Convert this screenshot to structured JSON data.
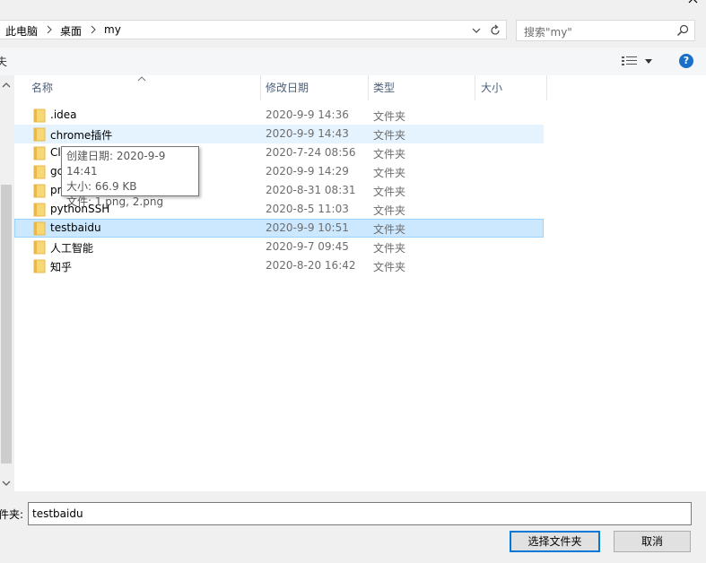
{
  "breadcrumb": [
    "此电脑",
    "桌面",
    "my"
  ],
  "search": {
    "placeholder": "搜索\"my\""
  },
  "toolbar": {
    "left_partial": "夫"
  },
  "columns": {
    "name": "名称",
    "date": "修改日期",
    "type": "类型",
    "size": "大小"
  },
  "files": [
    {
      "name": ".idea",
      "date": "2020-9-9 14:36",
      "type": "文件夹"
    },
    {
      "name": "chrome插件",
      "date": "2020-9-9 14:43",
      "type": "文件夹"
    },
    {
      "name": "Cl",
      "date": "2020-7-24 08:56",
      "type": "文件夹"
    },
    {
      "name": "gc",
      "date": "2020-9-9 14:29",
      "type": "文件夹"
    },
    {
      "name": "pr",
      "date": "2020-8-31 08:31",
      "type": "文件夹"
    },
    {
      "name": "pythonSSH",
      "date": "2020-8-5 11:03",
      "type": "文件夹"
    },
    {
      "name": "testbaidu",
      "date": "2020-9-9 10:51",
      "type": "文件夹"
    },
    {
      "name": "人工智能",
      "date": "2020-9-7 09:45",
      "type": "文件夹"
    },
    {
      "name": "知乎",
      "date": "2020-8-20 16:42",
      "type": "文件夹"
    }
  ],
  "tooltip": {
    "line1": "创建日期: 2020-9-9 14:41",
    "line2": "大小: 66.9 KB",
    "line3": "文件: 1.png, 2.png"
  },
  "filename": {
    "label": "件夹:",
    "value": "testbaidu"
  },
  "buttons": {
    "ok": "选择文件夹",
    "cancel": "取消"
  },
  "help_label": "?",
  "colors": {
    "accent": "#0078d7",
    "hover": "#e5f3ff",
    "selected": "#cce8ff",
    "folder": "#e8b84a"
  }
}
